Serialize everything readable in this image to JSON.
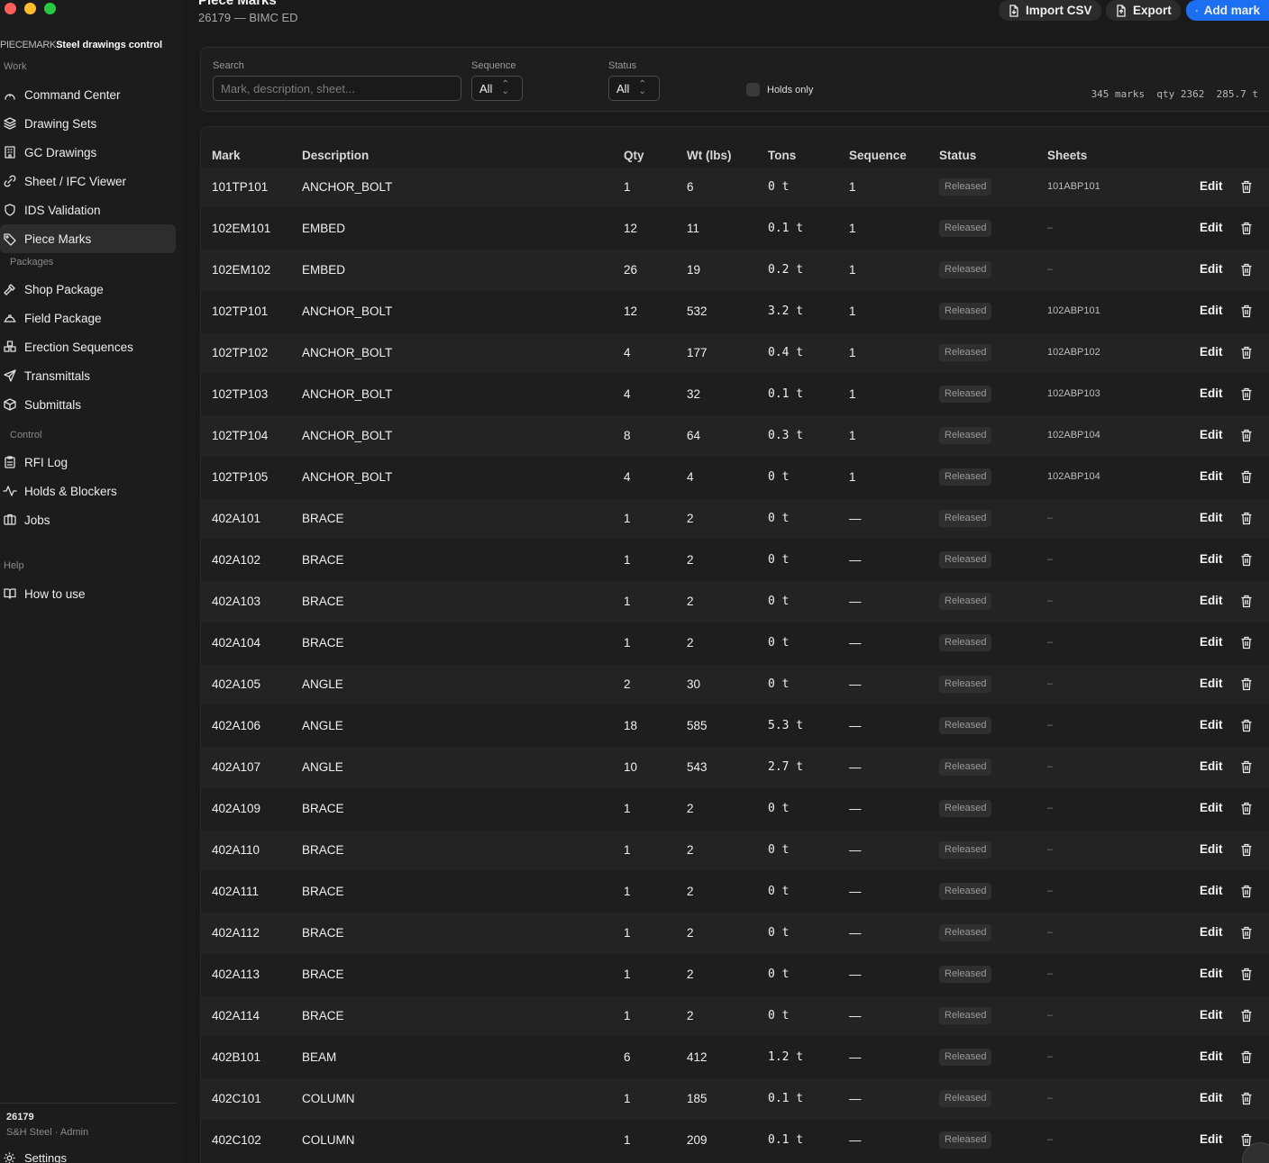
{
  "sidebar": {
    "brand_prefix": "PIECEMARK",
    "brand_name": "Steel drawings control",
    "sections": {
      "work": "Work",
      "packages": "Packages",
      "control": "Control",
      "help": "Help"
    },
    "items": [
      {
        "label": "Command Center",
        "icon": "home-icon"
      },
      {
        "label": "Drawing Sets",
        "icon": "layers-icon"
      },
      {
        "label": "GC Drawings",
        "icon": "building-icon"
      },
      {
        "label": "Sheet / IFC Viewer",
        "icon": "link-icon"
      },
      {
        "label": "IDS Validation",
        "icon": "shield-icon"
      },
      {
        "label": "Piece Marks",
        "icon": "tag-icon"
      },
      {
        "label": "Shop Package",
        "icon": "hammer-icon"
      },
      {
        "label": "Field Package",
        "icon": "hardhat-icon"
      },
      {
        "label": "Erection Sequences",
        "icon": "blocks-icon"
      },
      {
        "label": "Transmittals",
        "icon": "send-icon"
      },
      {
        "label": "Submittals",
        "icon": "package-icon"
      },
      {
        "label": "RFI Log",
        "icon": "clipboard-icon"
      },
      {
        "label": "Holds & Blockers",
        "icon": "activity-icon"
      },
      {
        "label": "Jobs",
        "icon": "briefcase-icon"
      },
      {
        "label": "How to use",
        "icon": "book-icon"
      }
    ],
    "footer": {
      "job": "26179",
      "org": "S&H Steel · Admin",
      "settings": "Settings"
    }
  },
  "header": {
    "title": "Piece Marks",
    "subtitle": "26179 — BIMC ED",
    "import_label": "Import CSV",
    "export_label": "Export",
    "add_label": "Add mark"
  },
  "filters": {
    "search_label": "Search",
    "search_placeholder": "Mark, description, sheet...",
    "sequence_label": "Sequence",
    "sequence_value": "All",
    "status_label": "Status",
    "status_value": "All",
    "holds_label": "Holds only",
    "summary": "345 marks  qty 2362  285.7 t"
  },
  "table": {
    "columns": [
      "Mark",
      "Description",
      "Qty",
      "Wt (lbs)",
      "Tons",
      "Sequence",
      "Status",
      "Sheets"
    ],
    "edit_label": "Edit",
    "rows": [
      {
        "mark": "101TP101",
        "desc": "ANCHOR_BOLT",
        "qty": "1",
        "wt": "6",
        "tons": "0 t",
        "seq": "1",
        "status": "Released",
        "sheets": "101ABP101"
      },
      {
        "mark": "102EM101",
        "desc": "EMBED",
        "qty": "12",
        "wt": "11",
        "tons": "0.1 t",
        "seq": "1",
        "status": "Released",
        "sheets": "–"
      },
      {
        "mark": "102EM102",
        "desc": "EMBED",
        "qty": "26",
        "wt": "19",
        "tons": "0.2 t",
        "seq": "1",
        "status": "Released",
        "sheets": "–"
      },
      {
        "mark": "102TP101",
        "desc": "ANCHOR_BOLT",
        "qty": "12",
        "wt": "532",
        "tons": "3.2 t",
        "seq": "1",
        "status": "Released",
        "sheets": "102ABP101"
      },
      {
        "mark": "102TP102",
        "desc": "ANCHOR_BOLT",
        "qty": "4",
        "wt": "177",
        "tons": "0.4 t",
        "seq": "1",
        "status": "Released",
        "sheets": "102ABP102"
      },
      {
        "mark": "102TP103",
        "desc": "ANCHOR_BOLT",
        "qty": "4",
        "wt": "32",
        "tons": "0.1 t",
        "seq": "1",
        "status": "Released",
        "sheets": "102ABP103"
      },
      {
        "mark": "102TP104",
        "desc": "ANCHOR_BOLT",
        "qty": "8",
        "wt": "64",
        "tons": "0.3 t",
        "seq": "1",
        "status": "Released",
        "sheets": "102ABP104"
      },
      {
        "mark": "102TP105",
        "desc": "ANCHOR_BOLT",
        "qty": "4",
        "wt": "4",
        "tons": "0 t",
        "seq": "1",
        "status": "Released",
        "sheets": "102ABP104"
      },
      {
        "mark": "402A101",
        "desc": "BRACE",
        "qty": "1",
        "wt": "2",
        "tons": "0 t",
        "seq": "—",
        "status": "Released",
        "sheets": "–"
      },
      {
        "mark": "402A102",
        "desc": "BRACE",
        "qty": "1",
        "wt": "2",
        "tons": "0 t",
        "seq": "—",
        "status": "Released",
        "sheets": "–"
      },
      {
        "mark": "402A103",
        "desc": "BRACE",
        "qty": "1",
        "wt": "2",
        "tons": "0 t",
        "seq": "—",
        "status": "Released",
        "sheets": "–"
      },
      {
        "mark": "402A104",
        "desc": "BRACE",
        "qty": "1",
        "wt": "2",
        "tons": "0 t",
        "seq": "—",
        "status": "Released",
        "sheets": "–"
      },
      {
        "mark": "402A105",
        "desc": "ANGLE",
        "qty": "2",
        "wt": "30",
        "tons": "0 t",
        "seq": "—",
        "status": "Released",
        "sheets": "–"
      },
      {
        "mark": "402A106",
        "desc": "ANGLE",
        "qty": "18",
        "wt": "585",
        "tons": "5.3 t",
        "seq": "—",
        "status": "Released",
        "sheets": "–"
      },
      {
        "mark": "402A107",
        "desc": "ANGLE",
        "qty": "10",
        "wt": "543",
        "tons": "2.7 t",
        "seq": "—",
        "status": "Released",
        "sheets": "–"
      },
      {
        "mark": "402A109",
        "desc": "BRACE",
        "qty": "1",
        "wt": "2",
        "tons": "0 t",
        "seq": "—",
        "status": "Released",
        "sheets": "–"
      },
      {
        "mark": "402A110",
        "desc": "BRACE",
        "qty": "1",
        "wt": "2",
        "tons": "0 t",
        "seq": "—",
        "status": "Released",
        "sheets": "–"
      },
      {
        "mark": "402A111",
        "desc": "BRACE",
        "qty": "1",
        "wt": "2",
        "tons": "0 t",
        "seq": "—",
        "status": "Released",
        "sheets": "–"
      },
      {
        "mark": "402A112",
        "desc": "BRACE",
        "qty": "1",
        "wt": "2",
        "tons": "0 t",
        "seq": "—",
        "status": "Released",
        "sheets": "–"
      },
      {
        "mark": "402A113",
        "desc": "BRACE",
        "qty": "1",
        "wt": "2",
        "tons": "0 t",
        "seq": "—",
        "status": "Released",
        "sheets": "–"
      },
      {
        "mark": "402A114",
        "desc": "BRACE",
        "qty": "1",
        "wt": "2",
        "tons": "0 t",
        "seq": "—",
        "status": "Released",
        "sheets": "–"
      },
      {
        "mark": "402B101",
        "desc": "BEAM",
        "qty": "6",
        "wt": "412",
        "tons": "1.2 t",
        "seq": "—",
        "status": "Released",
        "sheets": "–"
      },
      {
        "mark": "402C101",
        "desc": "COLUMN",
        "qty": "1",
        "wt": "185",
        "tons": "0.1 t",
        "seq": "—",
        "status": "Released",
        "sheets": "–"
      },
      {
        "mark": "402C102",
        "desc": "COLUMN",
        "qty": "1",
        "wt": "209",
        "tons": "0.1 t",
        "seq": "—",
        "status": "Released",
        "sheets": "–"
      }
    ]
  },
  "colors": {
    "accent": "#1b6ff0",
    "background": "#1a1a1a",
    "panel": "#1e1e1e",
    "badge": "#2f2f2f"
  }
}
